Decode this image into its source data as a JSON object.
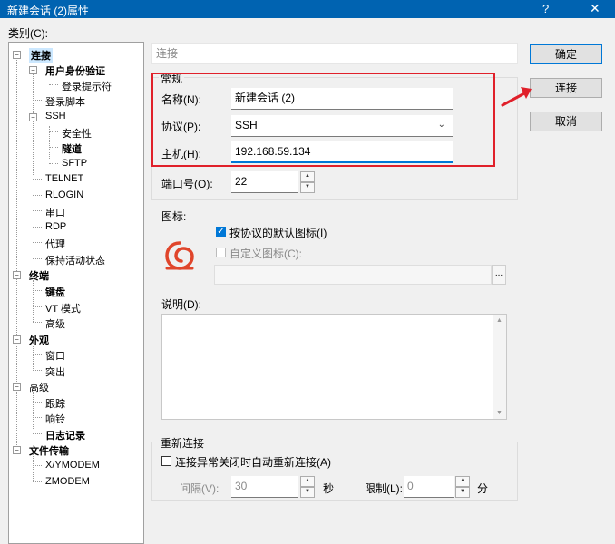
{
  "window": {
    "title": "新建会话 (2)属性",
    "help": "?",
    "close": "✕"
  },
  "category_label": "类别(C):",
  "tree": {
    "connection": "连接",
    "user_auth": "用户身份验证",
    "login_prompt": "登录提示符",
    "login_script": "登录脚本",
    "ssh": "SSH",
    "security": "安全性",
    "tunnel": "隧道",
    "sftp": "SFTP",
    "telnet": "TELNET",
    "rlogin": "RLOGIN",
    "serial": "串口",
    "rdp": "RDP",
    "proxy": "代理",
    "keepalive": "保持活动状态",
    "terminal": "终端",
    "keyboard": "键盘",
    "vt_mode": "VT 模式",
    "term_advanced": "高级",
    "appearance": "外观",
    "window": "窗口",
    "highlight": "突出",
    "advanced": "高级",
    "trace": "跟踪",
    "bell": "响铃",
    "logging": "日志记录",
    "file_transfer": "文件传输",
    "xymodem": "X/YMODEM",
    "zmodem": "ZMODEM"
  },
  "panel_header": "连接",
  "general": {
    "legend": "常规",
    "name_label": "名称(N):",
    "name_value": "新建会话 (2)",
    "protocol_label": "协议(P):",
    "protocol_value": "SSH",
    "host_label": "主机(H):",
    "host_value": "192.168.59.134",
    "port_label": "端口号(O):",
    "port_value": "22"
  },
  "icon": {
    "label": "图标:",
    "default_label": "按协议的默认图标(I)",
    "custom_label": "自定义图标(C):",
    "browse": "..."
  },
  "description_label": "说明(D):",
  "reconnect": {
    "legend": "重新连接",
    "auto_label": "连接异常关闭时自动重新连接(A)",
    "interval_label": "间隔(V):",
    "interval_value": "30",
    "sec": "秒",
    "limit_label": "限制(L):",
    "limit_value": "0",
    "min": "分"
  },
  "buttons": {
    "ok": "确定",
    "connect": "连接",
    "cancel": "取消"
  },
  "colors": {
    "titlebar": "#0063b1",
    "accent": "#0078d7",
    "highlight_border": "#e0202a",
    "icon": "#e0452b"
  }
}
